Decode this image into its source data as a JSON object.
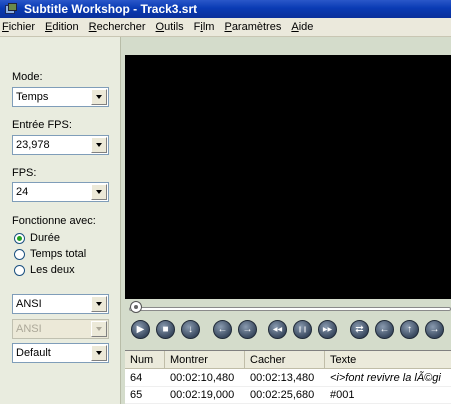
{
  "window": {
    "title": "Subtitle Workshop - Track3.srt"
  },
  "menu": [
    {
      "pre": "",
      "ul": "F",
      "post": "ichier"
    },
    {
      "pre": "",
      "ul": "E",
      "post": "dition"
    },
    {
      "pre": "",
      "ul": "R",
      "post": "echercher"
    },
    {
      "pre": "",
      "ul": "O",
      "post": "utils"
    },
    {
      "pre": "F",
      "ul": "i",
      "post": "lm"
    },
    {
      "pre": "",
      "ul": "P",
      "post": "aramètres"
    },
    {
      "pre": "",
      "ul": "A",
      "post": "ide"
    }
  ],
  "left": {
    "mode_label": "Mode:",
    "mode_value": "Temps",
    "fps_in_label": "Entrée FPS:",
    "fps_in_value": "23,978",
    "fps_label": "FPS:",
    "fps_value": "24",
    "works_label": "Fonctionne avec:",
    "radio_duree": "Durée",
    "radio_total": "Temps total",
    "radio_both": "Les deux",
    "radio_selected": "Durée",
    "charset1": "ANSI",
    "charset2": "ANSI",
    "style": "Default"
  },
  "player": {
    "buttons": [
      "play-icon",
      "stop-icon",
      "down-icon",
      "back-icon",
      "forward-icon",
      "rewind-icon",
      "pause-icon",
      "fast-forward-icon",
      "loop-icon",
      "left-arrow-icon",
      "up-arrow-icon",
      "right-arrow-icon",
      "add-icon"
    ]
  },
  "grid": {
    "headers": [
      "Num",
      "Montrer",
      "Cacher",
      "Texte"
    ],
    "rows": [
      {
        "num": "64",
        "show": "00:02:10,480",
        "hide": "00:02:13,480",
        "text": "<i>font revivre la lÃ©gi",
        "italic": true
      },
      {
        "num": "65",
        "show": "00:02:19,000",
        "hide": "00:02:25,680",
        "text": "#001",
        "italic": false
      }
    ]
  },
  "colors": {
    "title_bar": "#0a3bb4",
    "panel": "#e9ecdf",
    "video": "#000000"
  }
}
